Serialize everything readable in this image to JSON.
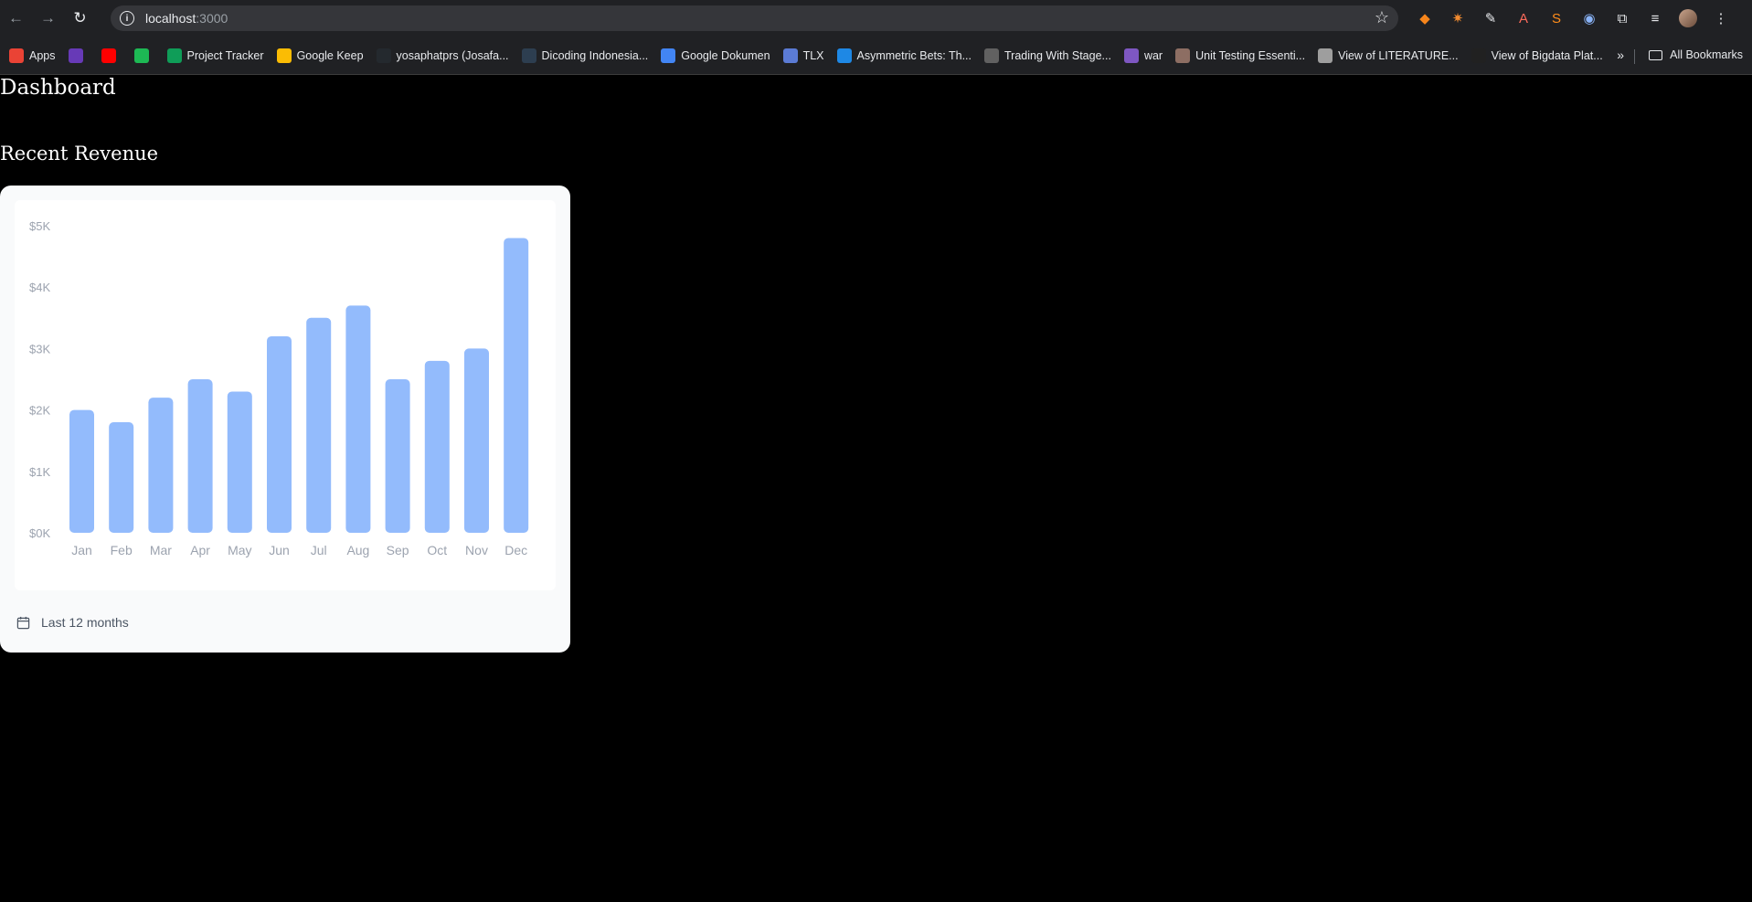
{
  "browser": {
    "url_host": "localhost",
    "url_port": ":3000",
    "bookmarks": [
      {
        "label": "Apps",
        "icon": "apps-grid-icon",
        "color": "#ea4335"
      },
      {
        "label": "",
        "icon": "badge-icon",
        "color": "#673ab7"
      },
      {
        "label": "",
        "icon": "youtube-icon",
        "color": "#ff0000"
      },
      {
        "label": "",
        "icon": "spotify-icon",
        "color": "#1db954"
      },
      {
        "label": "Project Tracker",
        "icon": "sheets-icon",
        "color": "#0f9d58"
      },
      {
        "label": "Google Keep",
        "icon": "keep-icon",
        "color": "#fbbc04"
      },
      {
        "label": "yosaphatprs (Josafa...",
        "icon": "github-icon",
        "color": "#24292e"
      },
      {
        "label": "Dicoding Indonesia...",
        "icon": "dicoding-icon",
        "color": "#2d3e50"
      },
      {
        "label": "Google Dokumen",
        "icon": "docs-icon",
        "color": "#4285f4"
      },
      {
        "label": "TLX",
        "icon": "tlx-icon",
        "color": "#5b7bd5"
      },
      {
        "label": "Asymmetric Bets: Th...",
        "icon": "asymmetric-icon",
        "color": "#1e88e5"
      },
      {
        "label": "Trading With Stage...",
        "icon": "trading-icon",
        "color": "#616161"
      },
      {
        "label": "war",
        "icon": "war-icon",
        "color": "#7e57c2"
      },
      {
        "label": "Unit Testing Essenti...",
        "icon": "unit-testing-icon",
        "color": "#8d6e63"
      },
      {
        "label": "View of LITERATURE...",
        "icon": "literature-icon",
        "color": "#9e9e9e"
      },
      {
        "label": "View of Bigdata Plat...",
        "icon": "pkp-icon",
        "color": "#212121"
      }
    ],
    "more_label": "»",
    "all_bookmarks_label": "All Bookmarks"
  },
  "page": {
    "title": "Dashboard",
    "section_title": "Recent Revenue",
    "footer_label": "Last 12 months"
  },
  "colors": {
    "bar": "#93bbfc",
    "axis_text": "#9ca3af"
  },
  "chart_data": {
    "type": "bar",
    "categories": [
      "Jan",
      "Feb",
      "Mar",
      "Apr",
      "May",
      "Jun",
      "Jul",
      "Aug",
      "Sep",
      "Oct",
      "Nov",
      "Dec"
    ],
    "values": [
      2000,
      1800,
      2200,
      2500,
      2300,
      3200,
      3500,
      3700,
      2500,
      2800,
      3000,
      4800
    ],
    "y_ticks": [
      "$5K",
      "$4K",
      "$3K",
      "$2K",
      "$1K",
      "$0K"
    ],
    "ylim": [
      0,
      5000
    ],
    "title": "",
    "xlabel": "",
    "ylabel": ""
  }
}
